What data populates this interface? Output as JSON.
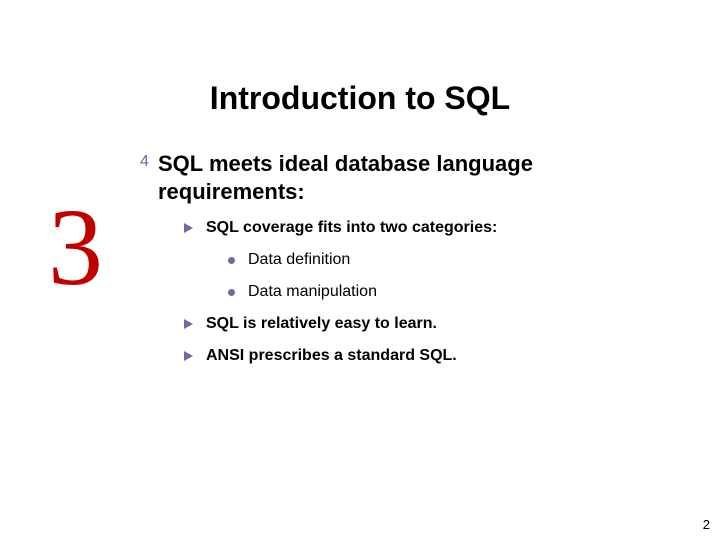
{
  "title": "Introduction to SQL",
  "chapter_number": "3",
  "content": {
    "l1": "SQL meets ideal database language requirements:",
    "l2a": "SQL coverage fits into two categories:",
    "l3a": "Data definition",
    "l3b": "Data manipulation",
    "l2b": "SQL is relatively easy to learn.",
    "l2c": "ANSI prescribes a standard SQL."
  },
  "page_number": "2"
}
